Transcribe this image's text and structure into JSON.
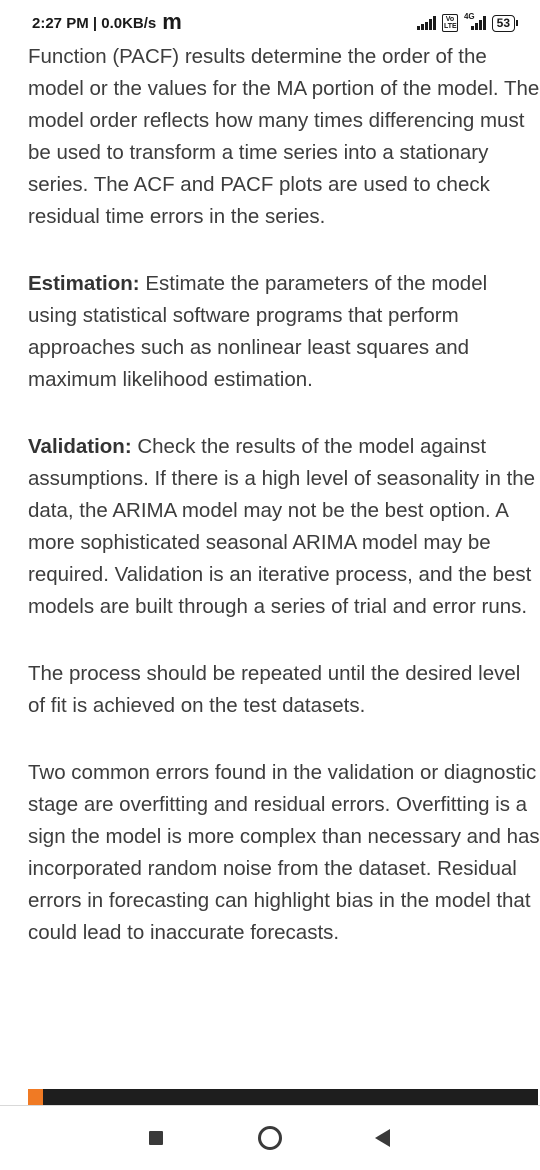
{
  "status_bar": {
    "time_and_speed": "2:27 PM | 0.0KB/s",
    "carrier_glyph": "m",
    "volte_label": "Vo LTE",
    "network_type": "4G",
    "battery_level": "53",
    "icons": [
      "signal-bars-icon",
      "volte-icon",
      "signal-bars-icon",
      "battery-icon"
    ]
  },
  "article": {
    "intro": "Function (PACF) results determine the order of the model or the values for the MA portion of the model. The model order reflects how many times differencing must be used to transform a time series into a stationary series. The ACF and PACF plots are used to check residual time errors in the series.",
    "estimation": {
      "term": "Estimation:",
      "text": " Estimate the parameters of the model using statistical software programs that perform approaches such as nonlinear least squares and maximum likelihood estimation."
    },
    "validation": {
      "term": "Validation:",
      "text": " Check the results of the model against assumptions. If there is a high level of seasonality in the data, the ARIMA model may not be the best option. A more sophisticated seasonal ARIMA model may be required. Validation is an iterative process, and the best models are built through a series of trial and error runs."
    },
    "repeat_note": "The process should be repeated until the desired level of fit is achieved on the test datasets.",
    "errors_note": "Two common errors found in the validation or diagnostic stage are overfitting and residual errors. Overfitting is a sign the model is more complex than necessary and has incorporated random noise from the dataset. Residual errors in forecasting can highlight bias in the model that could lead to inaccurate forecasts."
  },
  "reading_progress": 0.03,
  "colors": {
    "progress_accent": "#f07a24",
    "progress_track": "#1e1e1e",
    "body_text": "#3d3d3d"
  },
  "nav_bar": {
    "icons": [
      "recent-apps-icon",
      "home-icon",
      "back-icon"
    ]
  }
}
